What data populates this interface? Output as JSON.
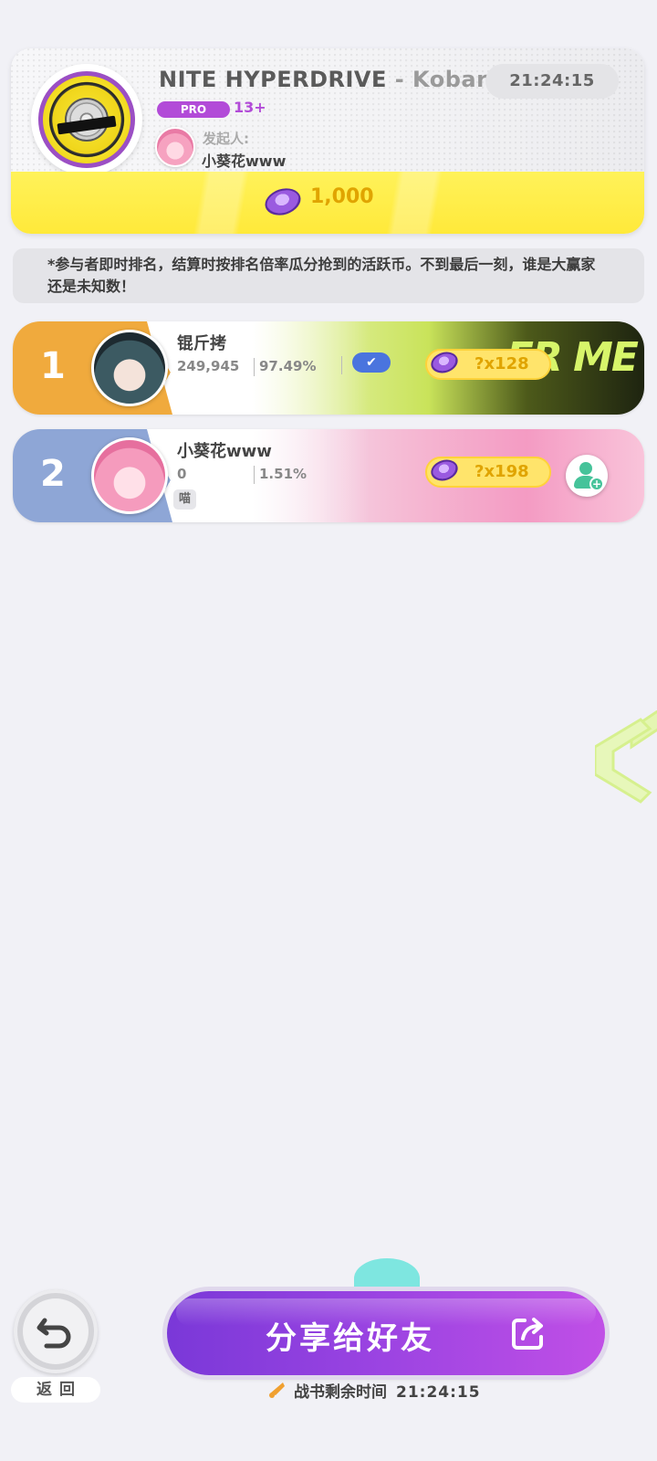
{
  "song": {
    "title": "NITE HYPERDRIVE",
    "artist_sep": " - ",
    "artist": "Kobary",
    "timer": "21:24:15",
    "difficulty_badge": "PRO",
    "level": "13+",
    "initiator_label": "发起人:",
    "initiator_name": "小葵花www",
    "reward_amount": "1,000"
  },
  "notice": "*参与者即时排名，结算时按排名倍率瓜分抢到的活跃币。不到最后一刻，谁是大赢家还是未知数！",
  "rankings": [
    {
      "rank": "1",
      "name": "锟斤拷",
      "score": "249,945",
      "accuracy": "97.49%",
      "multiplier": "?x128",
      "art_text": "ER ME"
    },
    {
      "rank": "2",
      "name": "小葵花www",
      "score": "0",
      "accuracy": "1.51%",
      "multiplier": "?x198",
      "tag": "喵"
    }
  ],
  "bottom": {
    "back_label": "返回",
    "share_label": "分享给好友",
    "remaining_label": "战书剩余时间",
    "remaining_time": "21:24:15"
  },
  "colors": {
    "rank1": "#f0aa3d",
    "rank2": "#8ea6d6",
    "accent_purple": "#9c44e2",
    "coin_gold": "#e0a400"
  },
  "icons": [
    "back-arrow-icon",
    "share-icon",
    "check-icon",
    "add-friend-icon",
    "coin-icon",
    "bell-icon"
  ]
}
